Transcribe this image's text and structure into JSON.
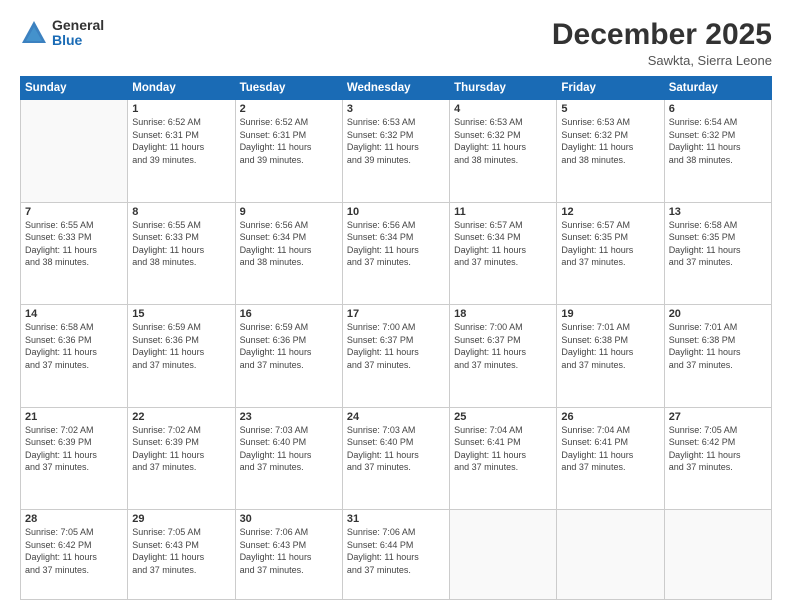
{
  "logo": {
    "general": "General",
    "blue": "Blue"
  },
  "title": "December 2025",
  "location": "Sawkta, Sierra Leone",
  "days_header": [
    "Sunday",
    "Monday",
    "Tuesday",
    "Wednesday",
    "Thursday",
    "Friday",
    "Saturday"
  ],
  "weeks": [
    [
      {
        "day": "",
        "info": ""
      },
      {
        "day": "1",
        "info": "Sunrise: 6:52 AM\nSunset: 6:31 PM\nDaylight: 11 hours\nand 39 minutes."
      },
      {
        "day": "2",
        "info": "Sunrise: 6:52 AM\nSunset: 6:31 PM\nDaylight: 11 hours\nand 39 minutes."
      },
      {
        "day": "3",
        "info": "Sunrise: 6:53 AM\nSunset: 6:32 PM\nDaylight: 11 hours\nand 39 minutes."
      },
      {
        "day": "4",
        "info": "Sunrise: 6:53 AM\nSunset: 6:32 PM\nDaylight: 11 hours\nand 38 minutes."
      },
      {
        "day": "5",
        "info": "Sunrise: 6:53 AM\nSunset: 6:32 PM\nDaylight: 11 hours\nand 38 minutes."
      },
      {
        "day": "6",
        "info": "Sunrise: 6:54 AM\nSunset: 6:32 PM\nDaylight: 11 hours\nand 38 minutes."
      }
    ],
    [
      {
        "day": "7",
        "info": "Sunrise: 6:55 AM\nSunset: 6:33 PM\nDaylight: 11 hours\nand 38 minutes."
      },
      {
        "day": "8",
        "info": "Sunrise: 6:55 AM\nSunset: 6:33 PM\nDaylight: 11 hours\nand 38 minutes."
      },
      {
        "day": "9",
        "info": "Sunrise: 6:56 AM\nSunset: 6:34 PM\nDaylight: 11 hours\nand 38 minutes."
      },
      {
        "day": "10",
        "info": "Sunrise: 6:56 AM\nSunset: 6:34 PM\nDaylight: 11 hours\nand 37 minutes."
      },
      {
        "day": "11",
        "info": "Sunrise: 6:57 AM\nSunset: 6:34 PM\nDaylight: 11 hours\nand 37 minutes."
      },
      {
        "day": "12",
        "info": "Sunrise: 6:57 AM\nSunset: 6:35 PM\nDaylight: 11 hours\nand 37 minutes."
      },
      {
        "day": "13",
        "info": "Sunrise: 6:58 AM\nSunset: 6:35 PM\nDaylight: 11 hours\nand 37 minutes."
      }
    ],
    [
      {
        "day": "14",
        "info": "Sunrise: 6:58 AM\nSunset: 6:36 PM\nDaylight: 11 hours\nand 37 minutes."
      },
      {
        "day": "15",
        "info": "Sunrise: 6:59 AM\nSunset: 6:36 PM\nDaylight: 11 hours\nand 37 minutes."
      },
      {
        "day": "16",
        "info": "Sunrise: 6:59 AM\nSunset: 6:36 PM\nDaylight: 11 hours\nand 37 minutes."
      },
      {
        "day": "17",
        "info": "Sunrise: 7:00 AM\nSunset: 6:37 PM\nDaylight: 11 hours\nand 37 minutes."
      },
      {
        "day": "18",
        "info": "Sunrise: 7:00 AM\nSunset: 6:37 PM\nDaylight: 11 hours\nand 37 minutes."
      },
      {
        "day": "19",
        "info": "Sunrise: 7:01 AM\nSunset: 6:38 PM\nDaylight: 11 hours\nand 37 minutes."
      },
      {
        "day": "20",
        "info": "Sunrise: 7:01 AM\nSunset: 6:38 PM\nDaylight: 11 hours\nand 37 minutes."
      }
    ],
    [
      {
        "day": "21",
        "info": "Sunrise: 7:02 AM\nSunset: 6:39 PM\nDaylight: 11 hours\nand 37 minutes."
      },
      {
        "day": "22",
        "info": "Sunrise: 7:02 AM\nSunset: 6:39 PM\nDaylight: 11 hours\nand 37 minutes."
      },
      {
        "day": "23",
        "info": "Sunrise: 7:03 AM\nSunset: 6:40 PM\nDaylight: 11 hours\nand 37 minutes."
      },
      {
        "day": "24",
        "info": "Sunrise: 7:03 AM\nSunset: 6:40 PM\nDaylight: 11 hours\nand 37 minutes."
      },
      {
        "day": "25",
        "info": "Sunrise: 7:04 AM\nSunset: 6:41 PM\nDaylight: 11 hours\nand 37 minutes."
      },
      {
        "day": "26",
        "info": "Sunrise: 7:04 AM\nSunset: 6:41 PM\nDaylight: 11 hours\nand 37 minutes."
      },
      {
        "day": "27",
        "info": "Sunrise: 7:05 AM\nSunset: 6:42 PM\nDaylight: 11 hours\nand 37 minutes."
      }
    ],
    [
      {
        "day": "28",
        "info": "Sunrise: 7:05 AM\nSunset: 6:42 PM\nDaylight: 11 hours\nand 37 minutes."
      },
      {
        "day": "29",
        "info": "Sunrise: 7:05 AM\nSunset: 6:43 PM\nDaylight: 11 hours\nand 37 minutes."
      },
      {
        "day": "30",
        "info": "Sunrise: 7:06 AM\nSunset: 6:43 PM\nDaylight: 11 hours\nand 37 minutes."
      },
      {
        "day": "31",
        "info": "Sunrise: 7:06 AM\nSunset: 6:44 PM\nDaylight: 11 hours\nand 37 minutes."
      },
      {
        "day": "",
        "info": ""
      },
      {
        "day": "",
        "info": ""
      },
      {
        "day": "",
        "info": ""
      }
    ]
  ]
}
